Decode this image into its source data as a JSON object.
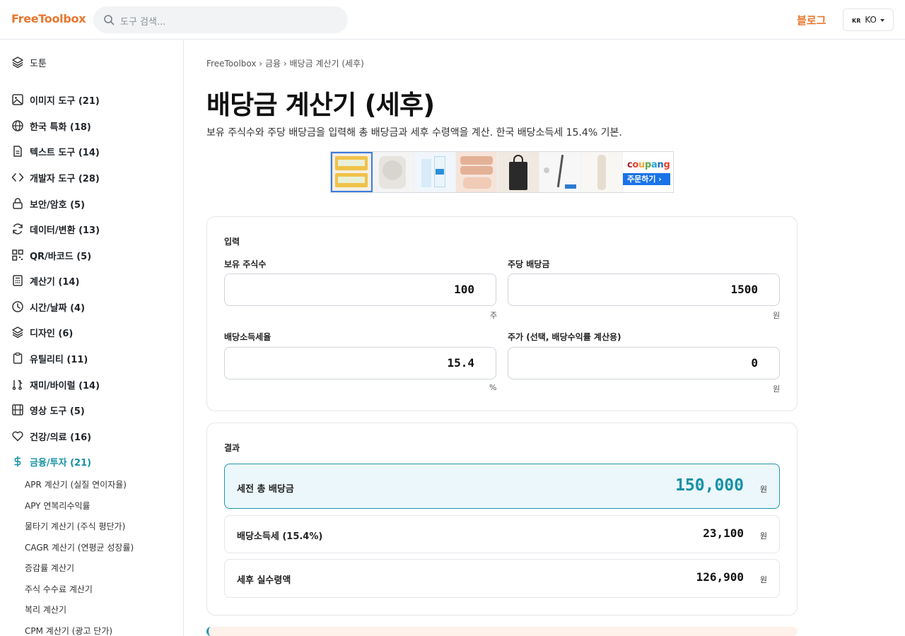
{
  "header": {
    "logo": "FreeToolbox",
    "search_placeholder": "도구 검색...",
    "blog_label": "블로그",
    "lang_flag": "KR",
    "lang_label": "KO"
  },
  "sidebar": {
    "top_item": "도툰",
    "categories": [
      {
        "label": "이미지 도구 (21)",
        "icon": "image-icon"
      },
      {
        "label": "한국 특화 (18)",
        "icon": "globe-icon"
      },
      {
        "label": "텍스트 도구 (14)",
        "icon": "document-icon"
      },
      {
        "label": "개발자 도구 (28)",
        "icon": "code-icon"
      },
      {
        "label": "보안/암호 (5)",
        "icon": "lock-icon"
      },
      {
        "label": "데이터/변환 (13)",
        "icon": "refresh-icon"
      },
      {
        "label": "QR/바코드 (5)",
        "icon": "qr-icon"
      },
      {
        "label": "계산기 (14)",
        "icon": "calculator-icon"
      },
      {
        "label": "시간/날짜 (4)",
        "icon": "clock-icon"
      },
      {
        "label": "디자인 (6)",
        "icon": "layers-icon"
      },
      {
        "label": "유틸리티 (11)",
        "icon": "clipboard-icon"
      },
      {
        "label": "재미/바이럴 (14)",
        "icon": "music-icon"
      },
      {
        "label": "영상 도구 (5)",
        "icon": "film-icon"
      },
      {
        "label": "건강/의료 (16)",
        "icon": "heart-icon"
      },
      {
        "label": "금융/투자 (21)",
        "icon": "dollar-icon",
        "active": true
      }
    ],
    "sub_items": [
      "APR 계산기 (실질 연이자율)",
      "APY 연복리수익률",
      "물타기 계산기 (주식 평단가)",
      "CAGR 계산기 (연평균 성장률)",
      "증감률 계산기",
      "주식 수수료 계산기",
      "복리 계산기",
      "CPM 계산기 (광고 단가)"
    ]
  },
  "breadcrumb": {
    "home": "FreeToolbox",
    "sep": "›",
    "category": "금융",
    "current": "배당금 계산기 (세후)"
  },
  "page": {
    "title": "배당금 계산기 (세후)",
    "description": "보유 주식수와 주당 배당금을 입력해 총 배당금과 세후 수령액을 계산. 한국 배당소득세 15.4% 기본."
  },
  "ad": {
    "brand_parts": [
      "c",
      "o",
      "u",
      "p",
      "a",
      "n",
      "g"
    ],
    "brand_colors": [
      "#a0262a",
      "#e8412f",
      "#f2a63b",
      "#5fa843",
      "#27a4d8",
      "#1f6fb5",
      "#e8412f"
    ],
    "order_label": "주문하기 ›"
  },
  "input_card": {
    "title": "입력",
    "fields": [
      {
        "label": "보유 주식수",
        "value": "100",
        "unit": "주"
      },
      {
        "label": "주당 배당금",
        "value": "1500",
        "unit": "원"
      },
      {
        "label": "배당소득세율",
        "value": "15.4",
        "unit": "%"
      },
      {
        "label": "주가 (선택, 배당수익률 계산용)",
        "value": "0",
        "unit": "원"
      }
    ]
  },
  "result_card": {
    "title": "결과",
    "rows": [
      {
        "label": "세전 총 배당금",
        "value": "150,000",
        "unit": "원",
        "highlight": true
      },
      {
        "label": "배당소득세 (15.4%)",
        "value": "23,100",
        "unit": "원"
      },
      {
        "label": "세후 실수령액",
        "value": "126,900",
        "unit": "원"
      }
    ]
  },
  "colors": {
    "brand_orange": "#e8772e",
    "accent_teal": "#1591a6"
  }
}
